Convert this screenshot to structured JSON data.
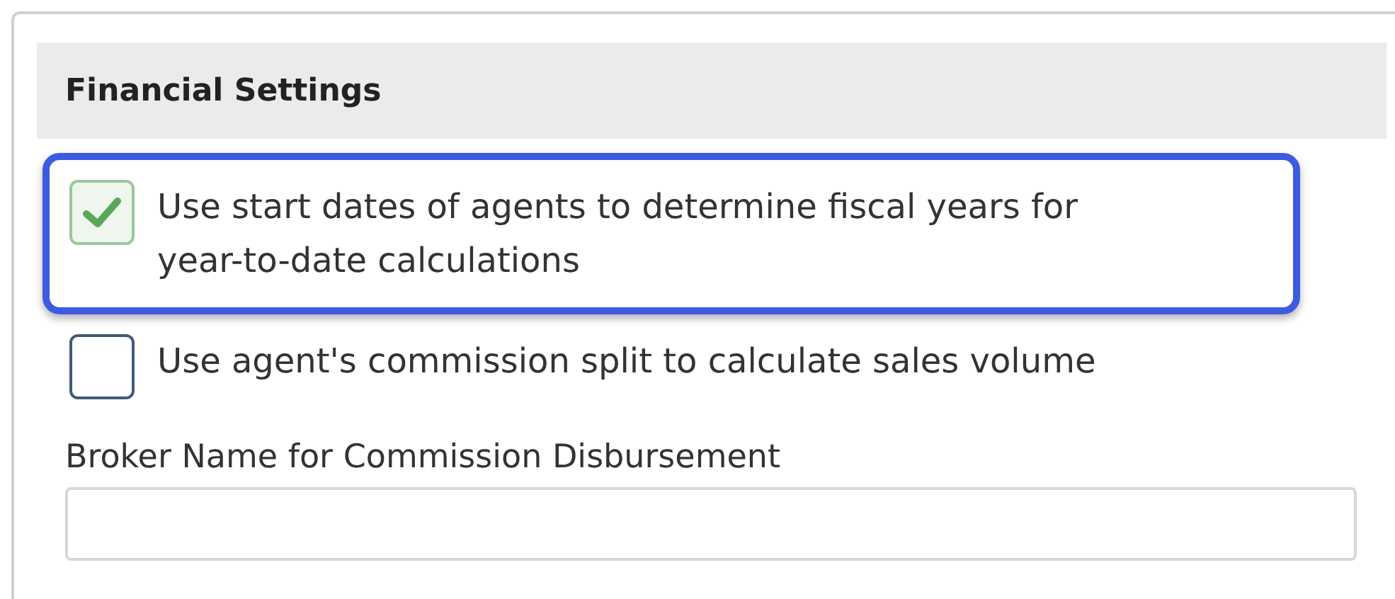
{
  "section": {
    "title": "Financial Settings"
  },
  "options": [
    {
      "label": "Use start dates of agents to determine fiscal years for year-to-date calculations",
      "checked": true,
      "highlighted": true
    },
    {
      "label": "Use agent's commission split to calculate sales volume",
      "checked": false,
      "highlighted": false
    }
  ],
  "field": {
    "label": "Broker Name for Commission Disbursement"
  }
}
